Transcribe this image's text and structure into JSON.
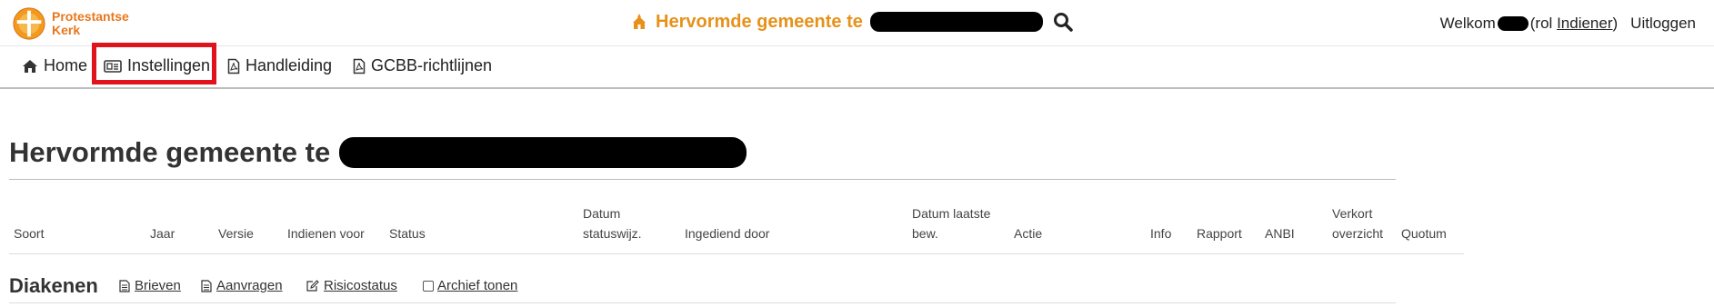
{
  "header": {
    "logo_line1": "Protestantse",
    "logo_line2": "Kerk",
    "title": "Hervormde gemeente te",
    "welcome": "Welkom",
    "role_prefix": "(rol",
    "role_link": "Indiener",
    "role_suffix": ")",
    "logout": "Uitloggen"
  },
  "nav": {
    "home": "Home",
    "settings": "Instellingen",
    "manual": "Handleiding",
    "guidelines": "GCBB-richtlijnen"
  },
  "page": {
    "title": "Hervormde gemeente te"
  },
  "table": {
    "headers": {
      "soort": "Soort",
      "jaar": "Jaar",
      "versie": "Versie",
      "indienen_voor": "Indienen voor",
      "status": "Status",
      "datum_statuswijz_1": "Datum",
      "datum_statuswijz_2": "statuswijz.",
      "ingediend_door": "Ingediend door",
      "datum_laatste_1": "Datum laatste",
      "datum_laatste_2": "bew.",
      "actie": "Actie",
      "info": "Info",
      "rapport": "Rapport",
      "anbi": "ANBI",
      "verkort_1": "Verkort",
      "verkort_2": "overzicht",
      "quotum": "Quotum"
    }
  },
  "section": {
    "title": "Diakenen",
    "links": {
      "brieven": "Brieven",
      "aanvragen": "Aanvragen",
      "risicostatus": "Risicostatus",
      "archief": "Archief tonen"
    }
  },
  "colors": {
    "brand_orange": "#e8911a",
    "highlight_red": "#e0121c"
  }
}
